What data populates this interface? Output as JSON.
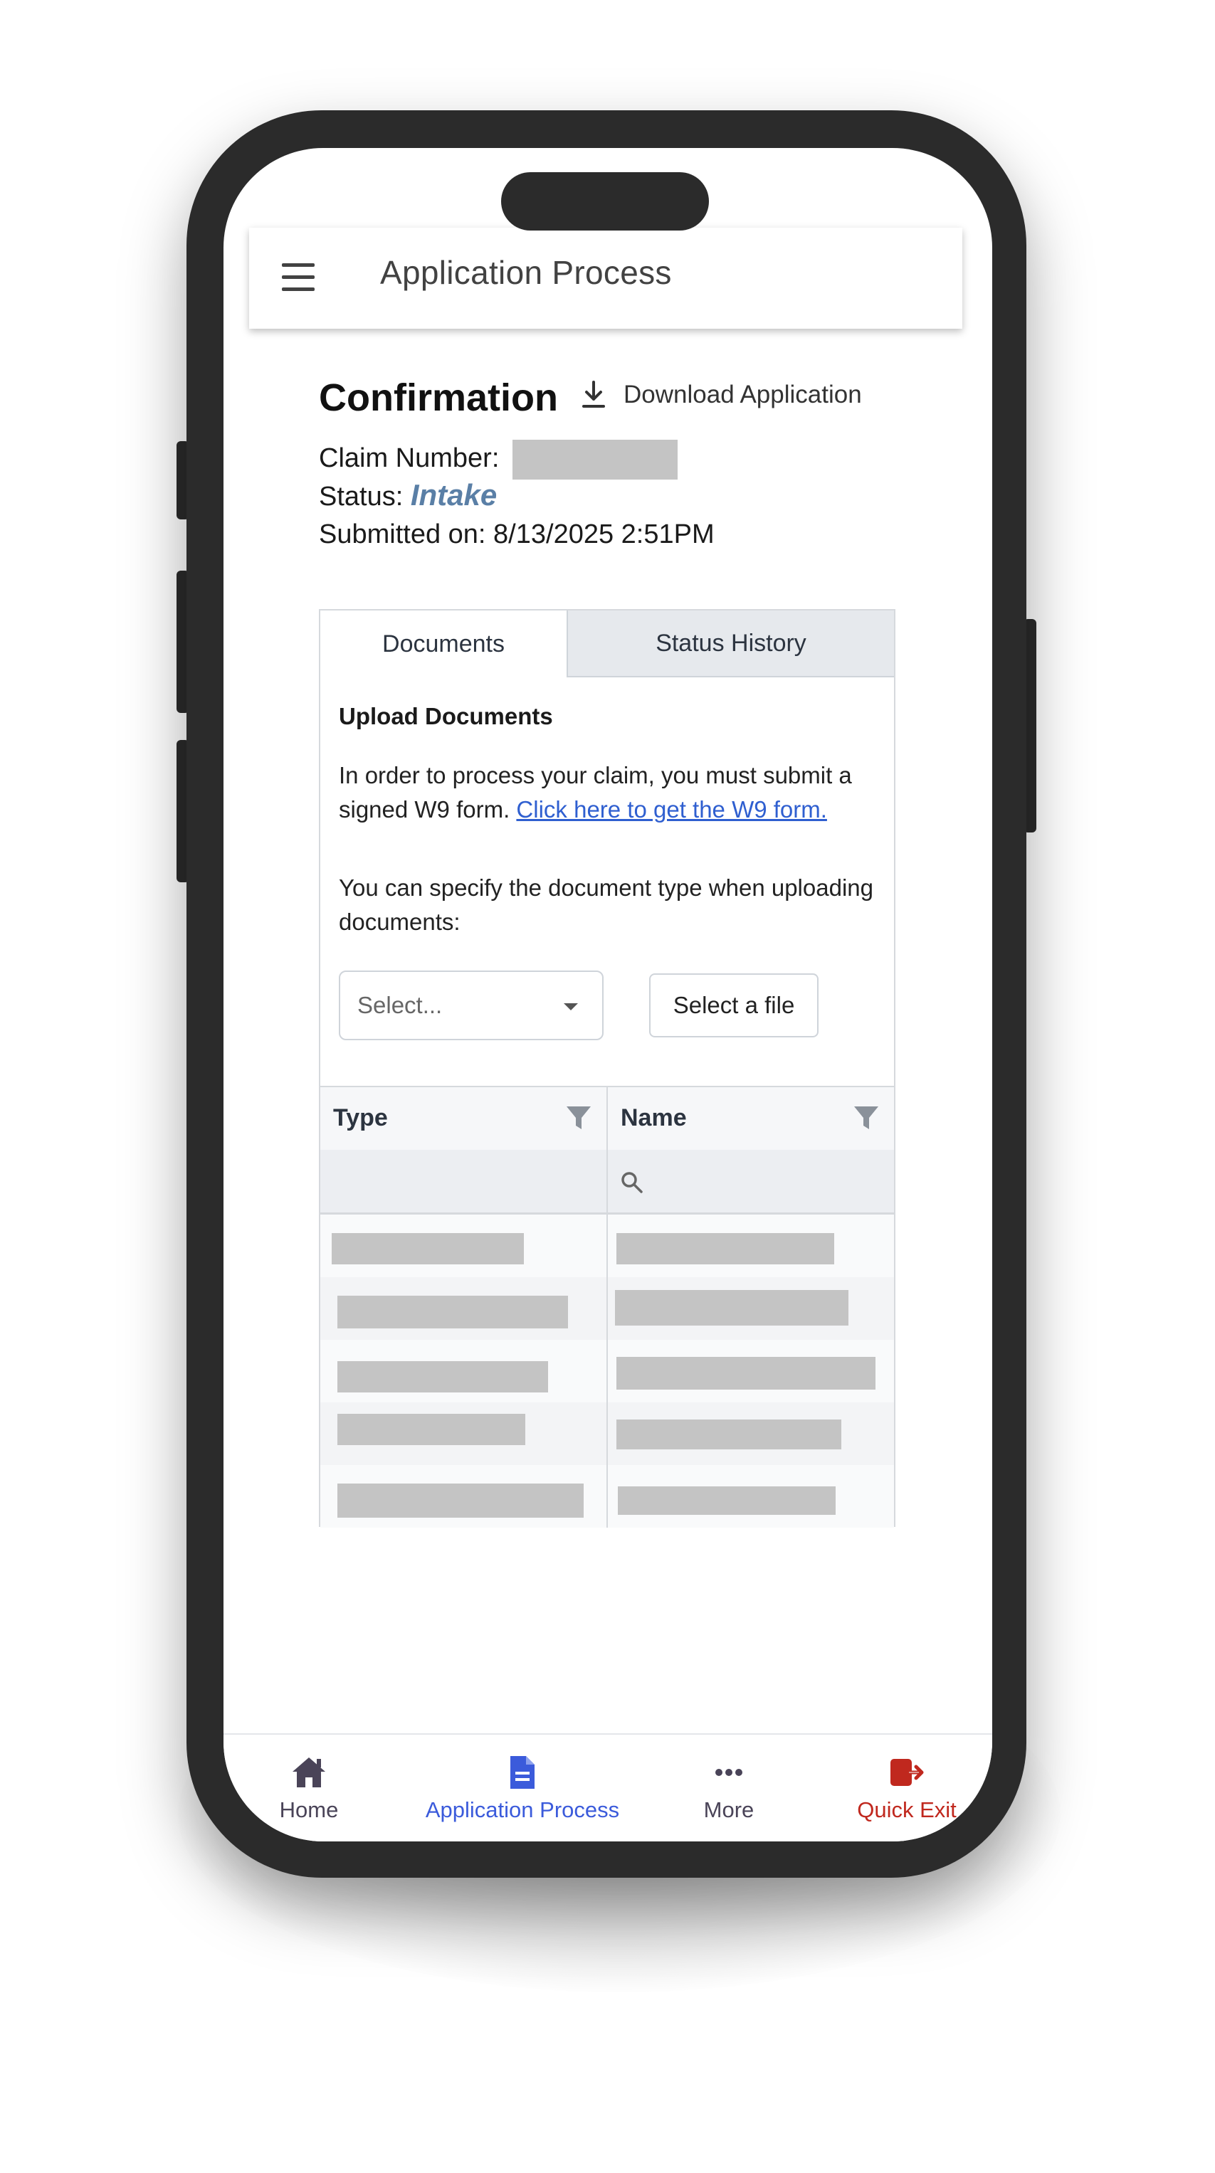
{
  "app_bar": {
    "title": "Application Process"
  },
  "confirmation": {
    "title": "Confirmation",
    "download_label": "Download Application",
    "claim_label": "Claim Number:",
    "status_label": "Status:",
    "status_value": "Intake",
    "submitted_label": "Submitted on:",
    "submitted_value": "8/13/2025 2:51PM"
  },
  "tabs": [
    {
      "label": "Documents",
      "active": true
    },
    {
      "label": "Status History",
      "active": false
    }
  ],
  "upload": {
    "heading": "Upload Documents",
    "instruction_text": "In order to process your claim, you must submit a signed W9 form. ",
    "w9_link": "Click here to get the W9 form.",
    "doc_type_text": "You can specify the document type when uploading documents:",
    "select_placeholder": "Select...",
    "file_button_label": "Select a file"
  },
  "documents_table": {
    "columns": [
      "Type",
      "Name"
    ],
    "row_count": 5
  },
  "bottom_nav": {
    "items": [
      {
        "label": "Home",
        "icon": "home-icon",
        "color": "#4a4458"
      },
      {
        "label": "Application Process",
        "icon": "document-icon",
        "color": "#3b5bdb"
      },
      {
        "label": "More",
        "icon": "more-icon",
        "color": "#4a4458"
      },
      {
        "label": "Quick Exit",
        "icon": "exit-icon",
        "color": "#c0281e"
      }
    ]
  },
  "colors": {
    "status_value": "#5a7fa6",
    "link": "#2f5fd0",
    "active_nav": "#3b5bdb",
    "quick_exit": "#c0281e"
  }
}
